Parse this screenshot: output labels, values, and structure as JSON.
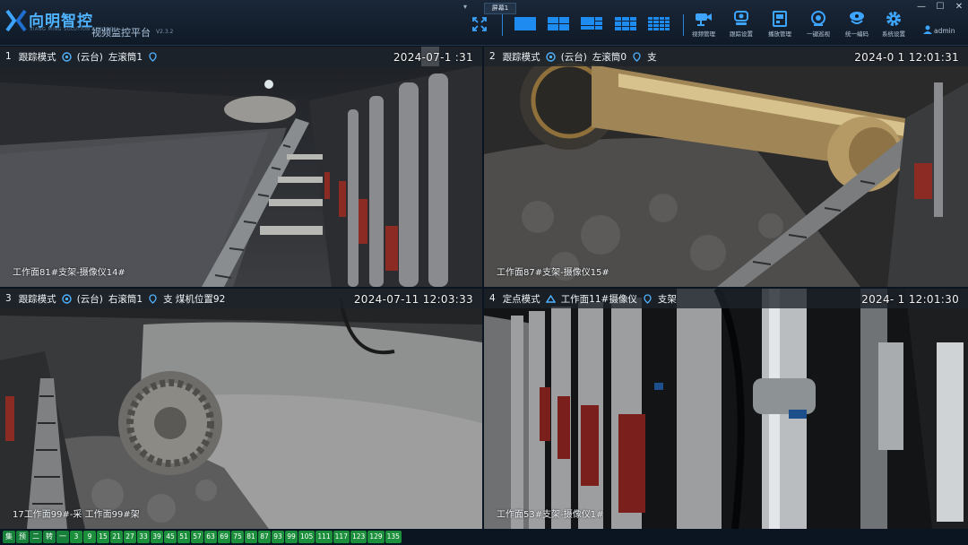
{
  "app": {
    "brand": "向明智控",
    "brand_sub": "XIANG MING SOLUTION CONTROL",
    "platform_title": "视频监控平台",
    "version": "V2.3.2"
  },
  "screen": {
    "selector": "▾",
    "tab": "屏幕1"
  },
  "toolbar": {
    "tools": [
      {
        "label": "视频管理",
        "icon": "camera-icon"
      },
      {
        "label": "跟踪设置",
        "icon": "tracking-icon"
      },
      {
        "label": "播放管理",
        "icon": "playback-icon"
      },
      {
        "label": "一键巡视",
        "icon": "patrol-icon"
      },
      {
        "label": "统一编码",
        "icon": "encode-icon"
      },
      {
        "label": "系统设置",
        "icon": "gear-icon"
      }
    ],
    "user": "admin"
  },
  "window": {
    "minimize": "—",
    "maximize": "☐",
    "close": "✕"
  },
  "panes": [
    {
      "num": "1",
      "mode": "跟踪模式",
      "ptz": "(云台)",
      "camera": "左滚筒1",
      "location": "",
      "timestamp": "2024-07-1     :31",
      "caption": "工作面81#支架-摄像仪14#"
    },
    {
      "num": "2",
      "mode": "跟踪模式",
      "ptz": "(云台)",
      "camera": "左滚筒0",
      "location": "支",
      "timestamp": "2024-0   1 12:01:31",
      "caption": "工作面87#支架-摄像仪15#"
    },
    {
      "num": "3",
      "mode": "跟踪模式",
      "ptz": "(云台)",
      "camera": "右滚筒1",
      "location": "支 煤机位置92",
      "timestamp": "2024-07-11 12:03:33",
      "caption": "17工作面99#-采 工作面99#架"
    },
    {
      "num": "4",
      "mode": "定点模式",
      "ptz": "",
      "camera": "工作面11#摄像仪",
      "location": "支架",
      "timestamp": "2024-  1 12:01:30",
      "caption": "工作面53#支架-摄像仪1#"
    }
  ],
  "bottom_chips": [
    "集",
    "预",
    "二",
    "转",
    "一",
    "3",
    "9",
    "15",
    "21",
    "27",
    "33",
    "39",
    "45",
    "51",
    "57",
    "63",
    "69",
    "75",
    "81",
    "87",
    "93",
    "99",
    "105",
    "111",
    "117",
    "123",
    "129",
    "135"
  ],
  "colors": {
    "accent": "#1e8bf0",
    "selected_border": "#2f82c8",
    "chip_green": "#1b8f3b"
  }
}
